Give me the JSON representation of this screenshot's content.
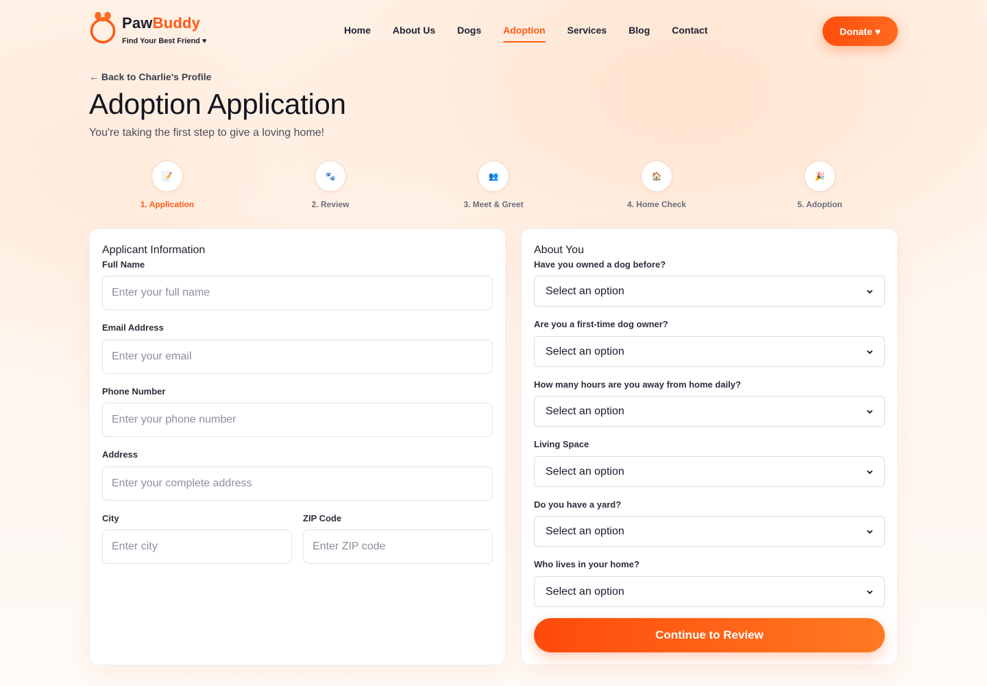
{
  "brand": {
    "name_part1": "Paw",
    "name_part2": "Buddy",
    "tagline": "Find Your Best Friend ♥",
    "accent_color": "#ff5a12"
  },
  "nav": {
    "items": [
      {
        "label": "Home",
        "active": false
      },
      {
        "label": "About Us",
        "active": false
      },
      {
        "label": "Dogs",
        "active": false
      },
      {
        "label": "Adoption",
        "active": true
      },
      {
        "label": "Services",
        "active": false
      },
      {
        "label": "Blog",
        "active": false
      },
      {
        "label": "Contact",
        "active": false
      }
    ],
    "donate_label": "Donate ♥"
  },
  "page": {
    "back_link": "← Back to Charlie's Profile",
    "title": "Adoption Application",
    "subtitle": "You're taking the first step to give a loving home!"
  },
  "steps": [
    {
      "label": "1. Application",
      "icon": "clipboard-icon",
      "glyph": "📝",
      "active": true
    },
    {
      "label": "2. Review",
      "icon": "paw-icon",
      "glyph": "🐾",
      "active": false
    },
    {
      "label": "3. Meet & Greet",
      "icon": "people-icon",
      "glyph": "👥",
      "active": false
    },
    {
      "label": "4. Home Check",
      "icon": "house-icon",
      "glyph": "🏠",
      "active": false
    },
    {
      "label": "5. Adoption",
      "icon": "party-icon",
      "glyph": "🎉",
      "active": false
    }
  ],
  "applicant": {
    "title": "Applicant Information",
    "full_name": {
      "label": "Full Name",
      "placeholder": "Enter your full name",
      "value": ""
    },
    "email": {
      "label": "Email Address",
      "placeholder": "Enter your email",
      "value": ""
    },
    "phone": {
      "label": "Phone Number",
      "placeholder": "Enter your phone number",
      "value": ""
    },
    "address": {
      "label": "Address",
      "placeholder": "Enter your complete address",
      "value": ""
    },
    "city": {
      "label": "City",
      "placeholder": "Enter city",
      "value": ""
    },
    "zip": {
      "label": "ZIP Code",
      "placeholder": "Enter ZIP code",
      "value": ""
    }
  },
  "about": {
    "title": "About You",
    "questions": [
      {
        "label": "Have you owned a dog before?",
        "selected": "Select an option"
      },
      {
        "label": "Are you a first-time dog owner?",
        "selected": "Select an option"
      },
      {
        "label": "How many hours are you away from home daily?",
        "selected": "Select an option"
      },
      {
        "label": "Living Space",
        "selected": "Select an option"
      },
      {
        "label": "Do you have a yard?",
        "selected": "Select an option"
      },
      {
        "label": "Who lives in your home?",
        "selected": "Select an option"
      }
    ],
    "continue_label": "Continue to Review"
  }
}
